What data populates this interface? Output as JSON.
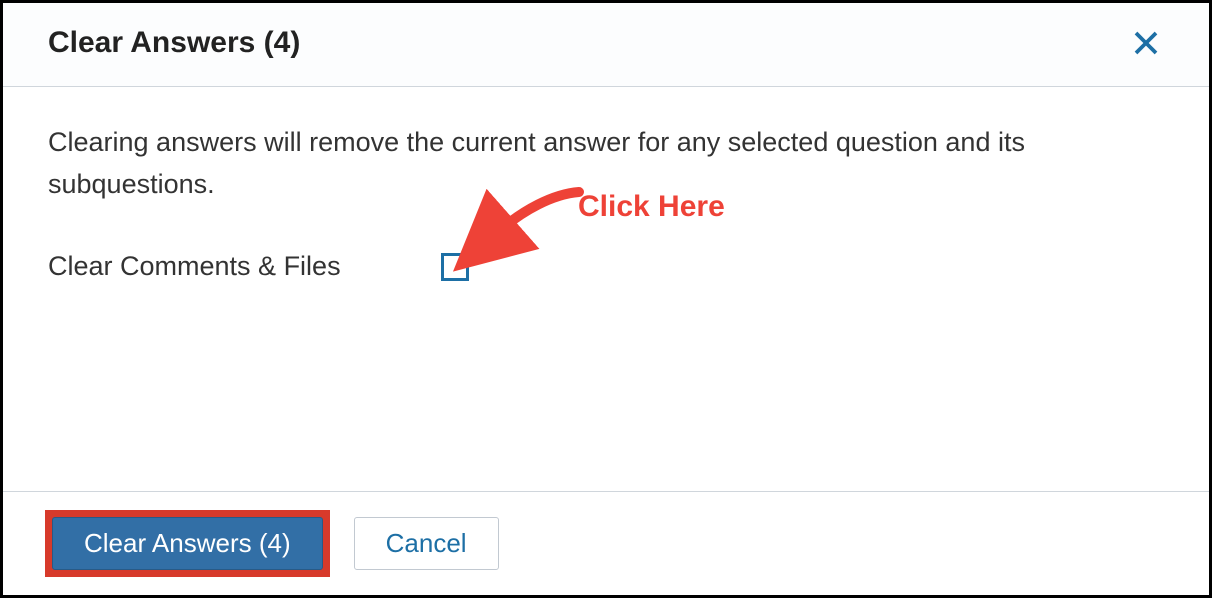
{
  "dialog": {
    "title": "Clear Answers (4)",
    "description": "Clearing answers will remove the current answer for any selected question and its subquestions.",
    "checkbox_label": "Clear Comments & Files",
    "checkbox_checked": false
  },
  "footer": {
    "clear_label": "Clear Answers (4)",
    "cancel_label": "Cancel"
  },
  "annotation": {
    "text": "Click Here",
    "color": "#ee4237"
  }
}
